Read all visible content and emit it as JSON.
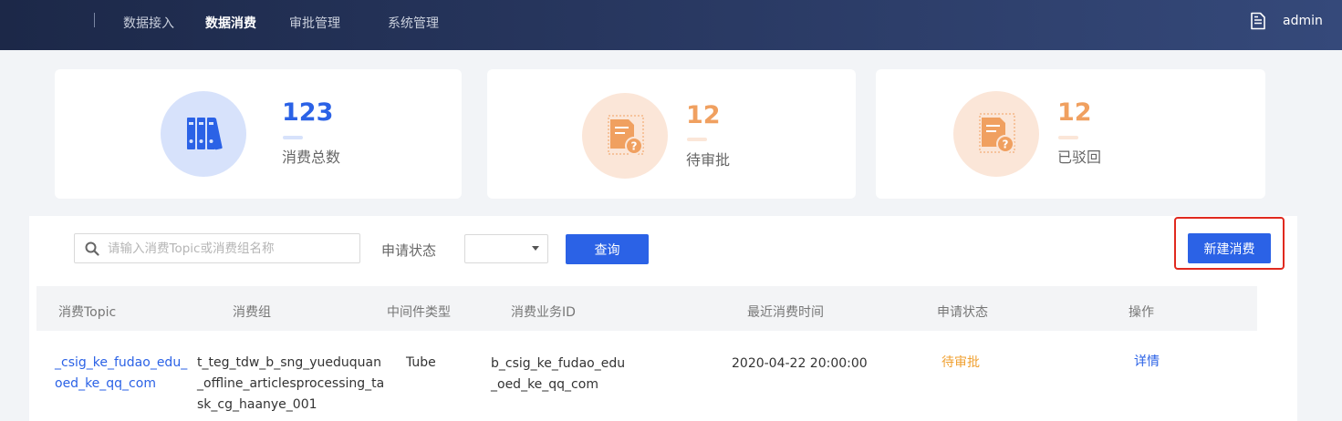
{
  "nav": {
    "items": [
      {
        "label": "数据接入"
      },
      {
        "label": "数据消费"
      },
      {
        "label": "审批管理"
      },
      {
        "label": "系统管理"
      }
    ],
    "active": "数据消费",
    "user": "admin"
  },
  "stats": [
    {
      "value": "123",
      "label": "消费总数",
      "color": "#2b62e6"
    },
    {
      "value": "12",
      "label": "待审批",
      "color": "#f0a060"
    },
    {
      "value": "12",
      "label": "已驳回",
      "color": "#f0a060"
    }
  ],
  "toolbar": {
    "search_placeholder": "请输入消费Topic或消费组名称",
    "status_label": "申请状态",
    "status_value": "",
    "query_label": "查询",
    "new_label": "新建消费"
  },
  "table": {
    "columns": [
      "消费Topic",
      "消费组",
      "中间件类型",
      "消费业务ID",
      "最近消费时间",
      "申请状态",
      "操作"
    ],
    "rows": [
      {
        "topic": [
          "_csig_ke_fudao_edu_",
          "oed_ke_qq_com"
        ],
        "group": [
          "t_teg_tdw_b_sng_yueduquan",
          "_offline_articlesprocessing_ta",
          "sk_cg_haanye_001"
        ],
        "middleware": "Tube",
        "biz_id": [
          "b_csig_ke_fudao_edu",
          "_oed_ke_qq_com"
        ],
        "last_time": "2020-04-22 20:00:00",
        "status": "待审批",
        "action": "详情"
      }
    ]
  },
  "colors": {
    "primary": "#2b62e6",
    "warning": "#f0a030",
    "highlight": "#e0291f",
    "nav_bg": "#1c2848"
  }
}
